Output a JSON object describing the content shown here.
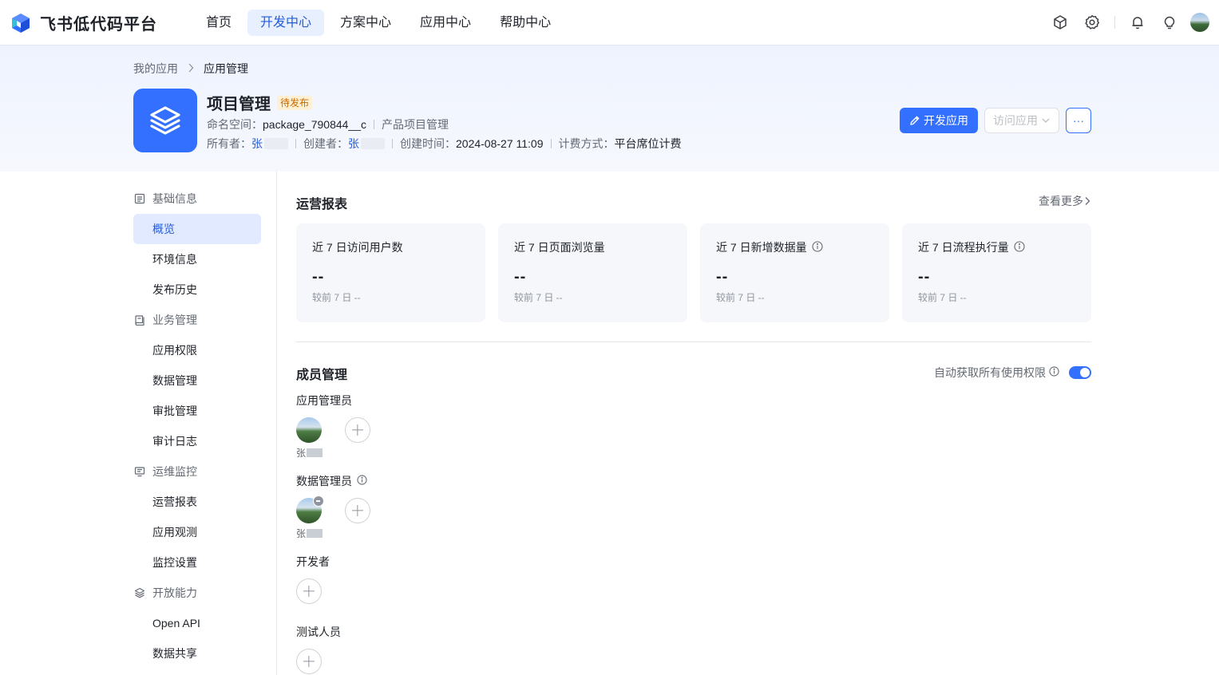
{
  "brand": {
    "name": "飞书低代码平台"
  },
  "nav": {
    "items": [
      {
        "label": "首页"
      },
      {
        "label": "开发中心"
      },
      {
        "label": "方案中心"
      },
      {
        "label": "应用中心"
      },
      {
        "label": "帮助中心"
      }
    ],
    "active": "开发中心"
  },
  "top_icons": [
    "package-icon",
    "settings-icon",
    "bell-icon",
    "lightbulb-icon",
    "user-avatar"
  ],
  "breadcrumb": {
    "parent": "我的应用",
    "current": "应用管理"
  },
  "app": {
    "name": "项目管理",
    "status": "待发布",
    "namespace_label": "命名空间：",
    "namespace": "package_790844__c",
    "description": "产品项目管理",
    "owner_label": "所有者：",
    "owner": "张",
    "creator_label": "创建者：",
    "creator": "张",
    "created_label": "创建时间：",
    "created": "2024-08-27 11:09",
    "billing_label": "计费方式：",
    "billing": "平台席位计费"
  },
  "actions": {
    "develop": "开发应用",
    "visit": "访问应用",
    "more": "···"
  },
  "sidebar": {
    "groups": [
      {
        "label": "基础信息",
        "icon": "document-icon",
        "items": [
          "概览",
          "环境信息",
          "发布历史"
        ]
      },
      {
        "label": "业务管理",
        "icon": "book-icon",
        "items": [
          "应用权限",
          "数据管理",
          "审批管理",
          "审计日志"
        ]
      },
      {
        "label": "运维监控",
        "icon": "monitor-icon",
        "items": [
          "运营报表",
          "应用观测",
          "监控设置"
        ]
      },
      {
        "label": "开放能力",
        "icon": "layers-icon",
        "items": [
          "Open API",
          "数据共享"
        ]
      }
    ],
    "active": "概览"
  },
  "report": {
    "title": "运营报表",
    "see_more": "查看更多",
    "cards": [
      {
        "label": "近 7 日访问用户数",
        "value": "--",
        "compare": "较前 7 日  --",
        "info": false
      },
      {
        "label": "近 7 日页面浏览量",
        "value": "--",
        "compare": "较前 7 日  --",
        "info": false
      },
      {
        "label": "近 7 日新增数据量",
        "value": "--",
        "compare": "较前 7 日  --",
        "info": true
      },
      {
        "label": "近 7 日流程执行量",
        "value": "--",
        "compare": "较前 7 日  --",
        "info": true
      }
    ]
  },
  "members": {
    "title": "成员管理",
    "auto_perm_label": "自动获取所有使用权限",
    "auto_perm_enabled": true,
    "roles": [
      {
        "label": "应用管理员",
        "members": [
          {
            "name": "张"
          }
        ]
      },
      {
        "label": "数据管理员",
        "members": [
          {
            "name": "张"
          }
        ]
      },
      {
        "label": "开发者",
        "members": []
      },
      {
        "label": "测试人员",
        "members": []
      }
    ]
  },
  "colors": {
    "primary": "#3370ff",
    "text": "#1f2329",
    "muted": "#646a73",
    "status_bg": "#fdf0d5",
    "status_text": "#c76a00"
  }
}
